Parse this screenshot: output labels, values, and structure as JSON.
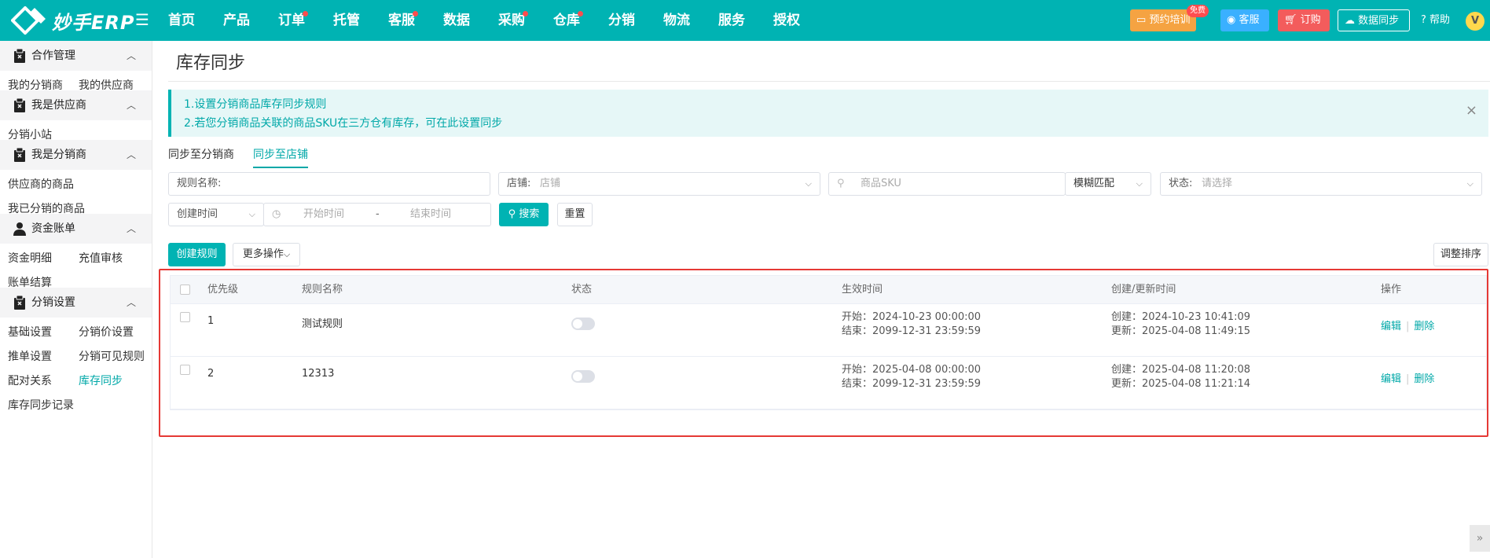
{
  "app": {
    "logo_text": "妙手ERP"
  },
  "nav": [
    {
      "label": "首页",
      "dot": false
    },
    {
      "label": "产品",
      "dot": false
    },
    {
      "label": "订单",
      "dot": true
    },
    {
      "label": "托管",
      "dot": false
    },
    {
      "label": "客服",
      "dot": true
    },
    {
      "label": "数据",
      "dot": false
    },
    {
      "label": "采购",
      "dot": true
    },
    {
      "label": "仓库",
      "dot": true
    },
    {
      "label": "分销",
      "dot": false
    },
    {
      "label": "物流",
      "dot": false
    },
    {
      "label": "服务",
      "dot": false
    },
    {
      "label": "授权",
      "dot": false
    }
  ],
  "topbar": {
    "training": "预约培训",
    "free_badge": "免费",
    "service": "客服",
    "order": "订购",
    "sync": "数据同步",
    "help": "帮助",
    "avatar_letter": "V"
  },
  "sidebar": {
    "groups": [
      {
        "label": "合作管理",
        "items": [
          "我的分销商",
          "我的供应商"
        ]
      },
      {
        "label": "我是供应商",
        "items": [
          "分销小站"
        ]
      },
      {
        "label": "我是分销商",
        "items": [
          "供应商的商品",
          "我已分销的商品"
        ]
      },
      {
        "label": "资金账单",
        "items": [
          "资金明细",
          "充值审核",
          "账单结算"
        ]
      },
      {
        "label": "分销设置",
        "items": [
          "基础设置",
          "分销价设置",
          "推单设置",
          "分销可见规则",
          "配对关系",
          "库存同步",
          "库存同步记录"
        ]
      }
    ],
    "active_item": "库存同步"
  },
  "page": {
    "title": "库存同步",
    "notice": {
      "line1": "1.设置分销商品库存同步规则",
      "line2": "2.若您分销商品关联的商品SKU在三方仓有库存，可在此设置同步",
      "close": "×"
    },
    "tabs": [
      "同步至分销商",
      "同步至店铺"
    ],
    "active_tab": 1
  },
  "filters": {
    "rule_name_label": "规则名称:",
    "shop_label": "店铺:",
    "shop_placeholder": "店铺",
    "sku_placeholder": "商品SKU",
    "match_mode": "模糊匹配",
    "status_label": "状态:",
    "status_placeholder": "请选择",
    "time_type": "创建时间",
    "start_placeholder": "开始时间",
    "range_sep": "-",
    "end_placeholder": "结束时间",
    "search": "搜索",
    "reset": "重置"
  },
  "actions": {
    "create_rule": "创建规则",
    "more_actions": "更多操作",
    "adjust_sort": "调整排序"
  },
  "table": {
    "headers": [
      "优先级",
      "规则名称",
      "状态",
      "生效时间",
      "创建/更新时间",
      "操作"
    ],
    "rows": [
      {
        "priority": "1",
        "name": "测试规则",
        "start": "开始：2024-10-23 00:00:00",
        "end": "结束：2099-12-31 23:59:59",
        "created": "创建：2024-10-23 10:41:09",
        "updated": "更新：2025-04-08 11:49:15",
        "edit": "编辑",
        "delete": "删除"
      },
      {
        "priority": "2",
        "name": "12313",
        "start": "开始：2025-04-08 00:00:00",
        "end": "结束：2099-12-31 23:59:59",
        "created": "创建：2025-04-08 11:20:08",
        "updated": "更新：2025-04-08 11:21:14",
        "edit": "编辑",
        "delete": "删除"
      }
    ]
  },
  "corner": "»"
}
